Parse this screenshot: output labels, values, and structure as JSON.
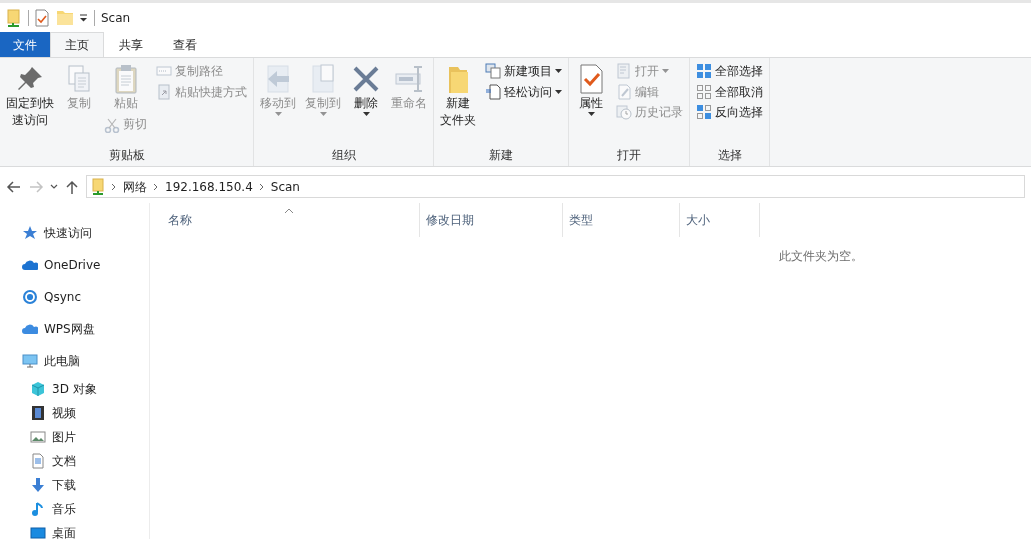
{
  "window": {
    "title": "Scan"
  },
  "ribbon_tabs": [
    {
      "label": "文件",
      "kind": "file",
      "selected": false
    },
    {
      "label": "主页",
      "kind": "tab",
      "selected": true
    },
    {
      "label": "共享",
      "kind": "tab",
      "selected": false
    },
    {
      "label": "查看",
      "kind": "tab",
      "selected": false
    }
  ],
  "ribbon_groups": [
    {
      "label": "剪贴板",
      "columns": [
        {
          "items": [
            {
              "label_lines": [
                "固定到快",
                "速访问"
              ],
              "kind": "large",
              "disabled": false,
              "dropdown": false
            }
          ]
        },
        {
          "items": [
            {
              "label": "复制",
              "kind": "large",
              "disabled": true,
              "dropdown": false
            }
          ]
        },
        {
          "items": [
            {
              "label": "粘贴",
              "kind": "large",
              "disabled": true,
              "dropdown": false
            },
            {
              "label": "剪切",
              "kind": "small",
              "disabled": true,
              "dropdown": false
            }
          ]
        },
        {
          "items": [
            {
              "label": "复制路径",
              "kind": "small",
              "disabled": true,
              "dropdown": false
            },
            {
              "label": "粘贴快捷方式",
              "kind": "small",
              "disabled": true,
              "dropdown": false
            }
          ]
        }
      ]
    },
    {
      "label": "组织",
      "columns": [
        {
          "items": [
            {
              "label": "移动到",
              "kind": "large",
              "disabled": true,
              "dropdown": true
            }
          ]
        },
        {
          "items": [
            {
              "label": "复制到",
              "kind": "large",
              "disabled": true,
              "dropdown": true
            }
          ]
        },
        {
          "items": [
            {
              "label": "删除",
              "kind": "large",
              "disabled": false,
              "dropdown": true
            }
          ]
        },
        {
          "items": [
            {
              "label": "重命名",
              "kind": "large",
              "disabled": true,
              "dropdown": false
            }
          ]
        }
      ]
    },
    {
      "label": "新建",
      "columns": [
        {
          "items": [
            {
              "label_lines": [
                "新建",
                "文件夹"
              ],
              "kind": "large",
              "disabled": false,
              "dropdown": false
            }
          ]
        },
        {
          "items": [
            {
              "label": "新建项目",
              "kind": "small",
              "disabled": false,
              "dropdown": true
            },
            {
              "label": "轻松访问",
              "kind": "small",
              "disabled": false,
              "dropdown": true
            }
          ]
        }
      ]
    },
    {
      "label": "打开",
      "columns": [
        {
          "items": [
            {
              "label": "属性",
              "kind": "large",
              "disabled": false,
              "dropdown": true
            }
          ]
        },
        {
          "items": [
            {
              "label": "打开",
              "kind": "small",
              "disabled": true,
              "dropdown": true
            },
            {
              "label": "编辑",
              "kind": "small",
              "disabled": true,
              "dropdown": false
            },
            {
              "label": "历史记录",
              "kind": "small",
              "disabled": true,
              "dropdown": false
            }
          ]
        }
      ]
    },
    {
      "label": "选择",
      "columns": [
        {
          "items": [
            {
              "label": "全部选择",
              "kind": "small",
              "disabled": false,
              "dropdown": false
            },
            {
              "label": "全部取消",
              "kind": "small",
              "disabled": false,
              "dropdown": false
            },
            {
              "label": "反向选择",
              "kind": "small",
              "disabled": false,
              "dropdown": false
            }
          ]
        }
      ]
    }
  ],
  "nav_buttons": [
    {
      "disabled": false
    },
    {
      "disabled": true
    },
    {
      "disabled": false
    },
    {
      "disabled": false
    }
  ],
  "address_bar": {
    "path": [
      "网络",
      "192.168.150.4",
      "Scan"
    ]
  },
  "sidebar": {
    "items": [
      {
        "label": "快速访问"
      },
      {
        "label": "OneDrive"
      },
      {
        "label": "Qsync"
      },
      {
        "label": "WPS网盘"
      },
      {
        "label": "此电脑",
        "children": [
          {
            "label": "3D 对象"
          },
          {
            "label": "视频"
          },
          {
            "label": "图片"
          },
          {
            "label": "文档"
          },
          {
            "label": "下载"
          },
          {
            "label": "音乐"
          },
          {
            "label": "桌面"
          }
        ]
      }
    ]
  },
  "file_list": {
    "columns": [
      "名称",
      "修改日期",
      "类型",
      "大小"
    ],
    "empty_message": "此文件夹为空。"
  }
}
